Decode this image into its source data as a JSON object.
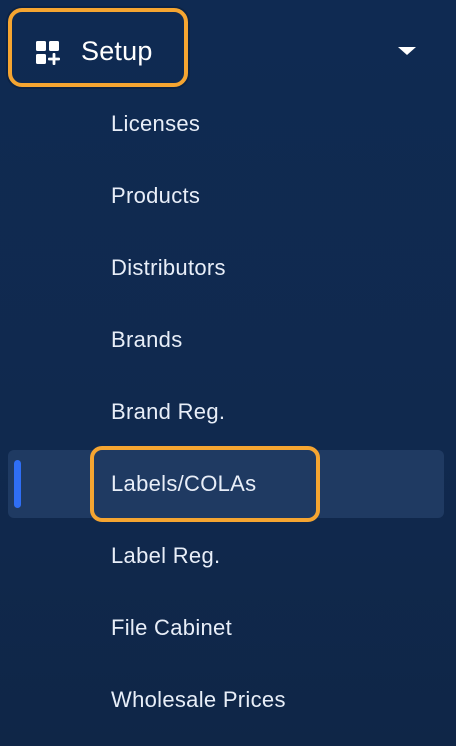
{
  "header": {
    "title": "Setup",
    "icon": "dashboard-add-icon",
    "toggle_icon": "chevron-down-icon"
  },
  "menu": {
    "active_index": 5,
    "items": [
      {
        "label": "Licenses"
      },
      {
        "label": "Products"
      },
      {
        "label": "Distributors"
      },
      {
        "label": "Brands"
      },
      {
        "label": "Brand Reg."
      },
      {
        "label": "Labels/COLAs"
      },
      {
        "label": "Label Reg."
      },
      {
        "label": "File Cabinet"
      },
      {
        "label": "Wholesale Prices"
      }
    ]
  },
  "colors": {
    "background": "#10294e",
    "highlight": "#f5a531",
    "active_indicator": "#2f6ef5",
    "active_background": "#1f3a62",
    "text": "#e8eef8"
  }
}
